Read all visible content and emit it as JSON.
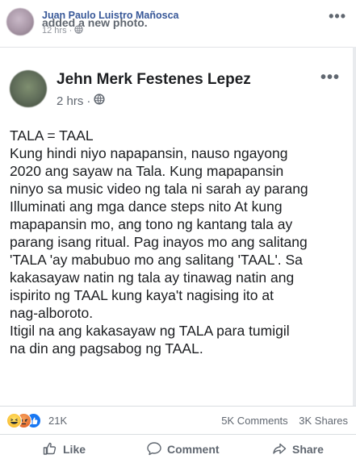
{
  "outer_post": {
    "author": "Juan Paulo Luistro Mañosca",
    "action_text": "added a new photo.",
    "time": "12 hrs",
    "more": "•••"
  },
  "shared_post": {
    "author": "Jehn Merk Festenes Lepez",
    "time": "2 hrs",
    "more": "•••",
    "body_lines": [
      "TALA = TAAL",
      "Kung hindi niyo napapansin, nauso ngayong",
      "2020 ang sayaw na Tala. Kung mapapansin",
      "ninyo sa music video ng tala ni sarah ay parang",
      "Illuminati ang mga dance steps nito At kung",
      "mapapansin mo, ang tono ng kantang tala ay",
      "parang isang ritual. Pag inayos mo ang salitang",
      "'TALA 'ay mabubuo mo ang salitang 'TAAL'. Sa",
      "kakasayaw natin ng tala ay tinawag natin ang",
      "ispirito ng TAAL kung kaya't nagising ito at",
      "nag-alboroto.",
      "Itigil na ang kakasayaw ng TALA para tumigil",
      "na din ang pagsabog ng TAAL."
    ]
  },
  "engagement": {
    "reaction_icons": [
      "haha-icon",
      "angry-icon",
      "like-icon"
    ],
    "reaction_count": "21K",
    "comments": "5K Comments",
    "shares": "3K Shares"
  },
  "actions": {
    "like": "Like",
    "comment": "Comment",
    "share": "Share"
  },
  "colors": {
    "link_blue": "#385898",
    "like_blue": "#1877f2",
    "meta_gray": "#606770"
  }
}
